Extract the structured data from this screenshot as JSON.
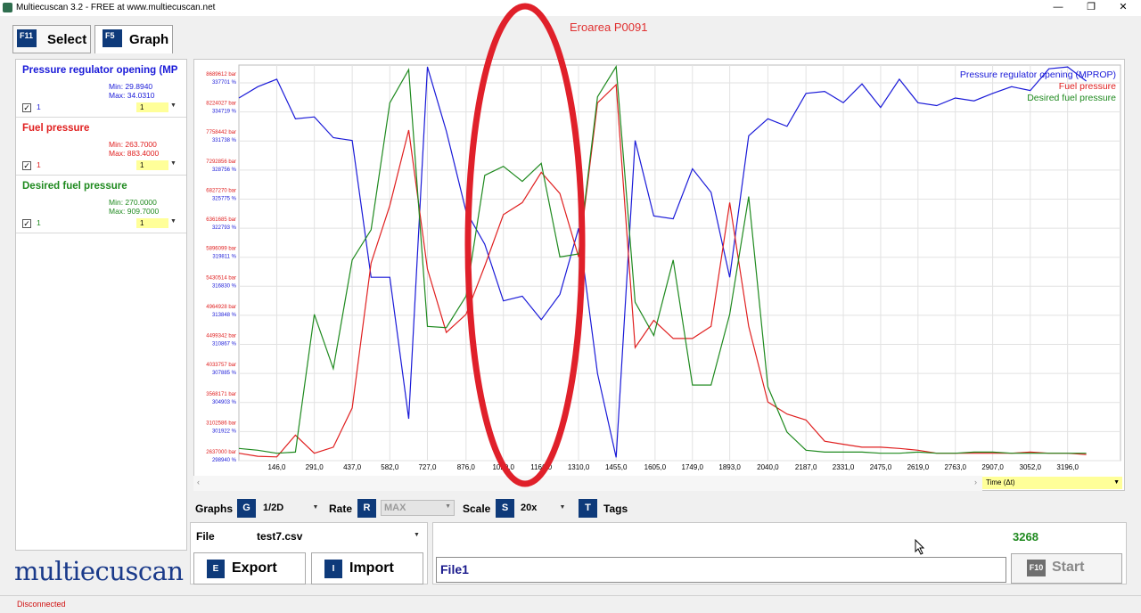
{
  "window": {
    "title": "Multiecuscan 3.2 - FREE at www.multiecuscan.net",
    "minimize": "—",
    "maximize": "❐",
    "close": "✕"
  },
  "tabs": [
    {
      "key": "F11",
      "label": "Select"
    },
    {
      "key": "F5",
      "label": "Graph"
    }
  ],
  "channels": [
    {
      "name": "Pressure regulator opening (MP",
      "min": "Min: 29.8940",
      "max": "Max: 34.0310",
      "num": "1",
      "select": "1",
      "color": "#1a1ad8"
    },
    {
      "name": "Fuel pressure",
      "min": "Min: 263.7000",
      "max": "Max: 883.4000",
      "num": "1",
      "select": "1",
      "color": "#e02020"
    },
    {
      "name": "Desired fuel pressure",
      "min": "Min: 270.0000",
      "max": "Max: 909.7000",
      "num": "1",
      "select": "1",
      "color": "#1f8a1f"
    }
  ],
  "chart_data": {
    "type": "line",
    "x": [
      0,
      73,
      146,
      218,
      291,
      364,
      437,
      510,
      582,
      655,
      727,
      800,
      876,
      948,
      1020,
      1093,
      1166,
      1238,
      1310,
      1383,
      1455,
      1528,
      1600,
      1675,
      1749,
      1821,
      1893,
      1966,
      2040,
      2114,
      2187,
      2259,
      2331,
      2403,
      2475,
      2547,
      2619,
      2691,
      2763,
      2835,
      2907,
      2980,
      3052,
      3124,
      3196,
      3268
    ],
    "x_tick_labels": [
      "146,0",
      "291,0",
      "437,0",
      "582,0",
      "727,0",
      "876,0",
      "1020,0",
      "1166,0",
      "1310,0",
      "1455,0",
      "1605,0",
      "1749,0",
      "1893,0",
      "2040,0",
      "2187,0",
      "2331,0",
      "2475,0",
      "2619,0",
      "2763,0",
      "2907,0",
      "3052,0",
      "3196,0"
    ],
    "y_left_labels_bar": [
      "8689612 bar",
      "8224027 bar",
      "7758442 bar",
      "7292856 bar",
      "6827270 bar",
      "6361685 bar",
      "5896099 bar",
      "5430514 bar",
      "4964928 bar",
      "4499342 bar",
      "4033757 bar",
      "3568171 bar",
      "3102586 bar",
      "2637000 bar"
    ],
    "y_left_labels_pct": [
      "337701 %",
      "334719 %",
      "331738 %",
      "328756 %",
      "325775 %",
      "322793 %",
      "319811 %",
      "316830 %",
      "313848 %",
      "310867 %",
      "307885 %",
      "304903 %",
      "301922 %",
      "298940 %"
    ],
    "series": [
      {
        "name": "Pressure regulator opening (MPROP)",
        "color": "#1a1ad8",
        "unit": "%",
        "values": [
          33.7,
          33.82,
          33.9,
          33.48,
          33.5,
          33.28,
          33.25,
          31.8,
          31.8,
          30.3,
          34.03,
          33.35,
          32.5,
          32.15,
          31.55,
          31.6,
          31.35,
          31.62,
          32.32,
          30.78,
          29.89,
          33.25,
          32.45,
          32.42,
          32.95,
          32.7,
          31.8,
          33.3,
          33.48,
          33.4,
          33.75,
          33.77,
          33.65,
          33.85,
          33.6,
          33.9,
          33.65,
          33.62,
          33.7,
          33.67,
          33.75,
          33.82,
          33.78,
          34.01,
          34.03,
          33.88
        ]
      },
      {
        "name": "Fuel pressure",
        "color": "#e02020",
        "unit": "bar",
        "values": [
          270,
          265,
          264,
          300,
          270,
          280,
          345,
          585,
          680,
          805,
          575,
          470,
          500,
          580,
          665,
          685,
          735,
          700,
          595,
          850,
          880,
          445,
          490,
          460,
          460,
          480,
          685,
          480,
          355,
          335,
          325,
          290,
          285,
          280,
          280,
          278,
          275,
          270,
          270,
          270,
          270,
          270,
          272,
          270,
          270,
          268
        ]
      },
      {
        "name": "Desired fuel pressure",
        "color": "#1f8a1f",
        "unit": "bar",
        "values": [
          278,
          275,
          270,
          272,
          500,
          410,
          590,
          640,
          850,
          905,
          480,
          478,
          530,
          730,
          745,
          720,
          750,
          595,
          600,
          860,
          910,
          520,
          465,
          590,
          383,
          383,
          500,
          695,
          380,
          305,
          275,
          272,
          272,
          272,
          270,
          270,
          272,
          270,
          270,
          272,
          272,
          270,
          270,
          270,
          270,
          270
        ]
      }
    ],
    "legend_position": "top-right",
    "grid": true
  },
  "scroll": {
    "left_arrow": "‹",
    "right_arrow": "›"
  },
  "time_select": {
    "value": "Time (Δt)"
  },
  "toolbar": {
    "graphs_label": "Graphs",
    "graphs_key": "G",
    "graphs_value": "1/2D",
    "rate_label": "Rate",
    "rate_key": "R",
    "rate_value": "MAX",
    "scale_label": "Scale",
    "scale_key": "S",
    "scale_value": "20x",
    "tags_key": "T",
    "tags_label": "Tags"
  },
  "file": {
    "label": "File",
    "name": "test7.csv",
    "export_key": "E",
    "export_label": "Export",
    "import_key": "I",
    "import_label": "Import"
  },
  "result": {
    "count": "3268",
    "filename": "File1",
    "start_key": "F10",
    "start_label": "Start"
  },
  "logo": "multiecuscan",
  "status": "Disconnected",
  "annotation": "Eroarea P0091",
  "colors": {
    "accent": "#0e3a7a",
    "annotation": "#e03030"
  }
}
